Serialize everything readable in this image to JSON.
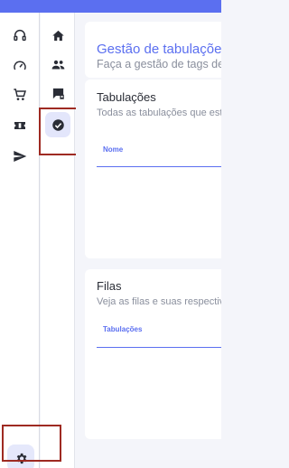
{
  "header": {
    "title": "Gestão de tabulações",
    "subtitle": "Faça a gestão de tags de"
  },
  "sections": [
    {
      "title": "Tabulações",
      "subtitle": "Todas as tabulações que est",
      "column": "Nome"
    },
    {
      "title": "Filas",
      "subtitle": "Veja as filas e suas respectiv",
      "column": "Tabulações"
    }
  ],
  "rail1": {
    "icons": [
      "headset-icon",
      "speedometer-icon",
      "cart-icon",
      "ticket-icon",
      "send-icon"
    ],
    "bottom": "settings-icon"
  },
  "rail2": {
    "icons": [
      "home-icon",
      "people-icon",
      "chat-flag-icon",
      "check-circle-icon"
    ],
    "active": "check-circle-icon"
  },
  "colors": {
    "accent": "#5b6ff0",
    "highlight": "#9e2a22",
    "icon": "#2a2d36"
  }
}
